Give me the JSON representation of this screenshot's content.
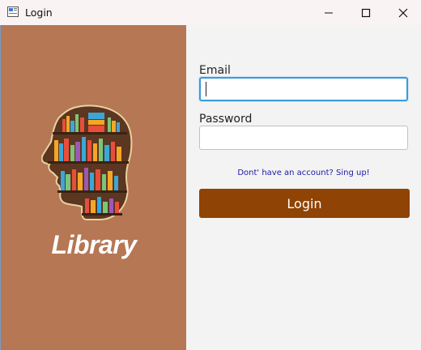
{
  "window": {
    "title": "Login"
  },
  "brand": {
    "name": "Library"
  },
  "form": {
    "email_label": "Email",
    "email_value": "",
    "password_label": "Password",
    "password_value": "",
    "signup_text": "Dont' have an account? Sing up!",
    "login_label": "Login"
  },
  "colors": {
    "left_panel": "#b57754",
    "login_button": "#8f4304",
    "focus_ring": "#3b9ad9",
    "link": "#1a1aa6"
  }
}
